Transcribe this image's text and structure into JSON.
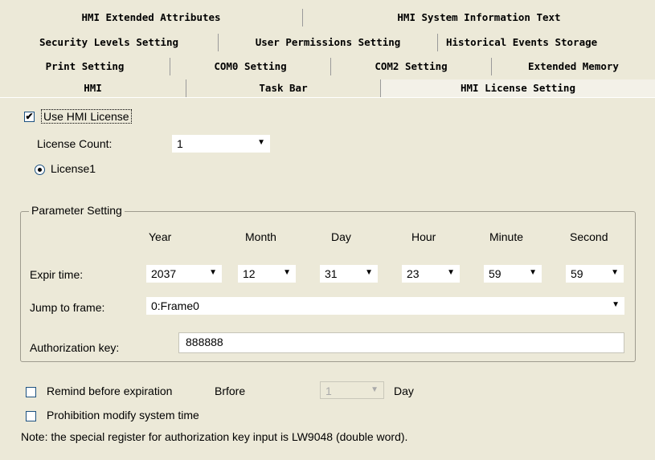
{
  "tabs": {
    "row1": [
      "HMI Extended Attributes",
      "HMI System Information Text"
    ],
    "row2": [
      "Security Levels Setting",
      "User Permissions Setting",
      "Historical Events Storage"
    ],
    "row3": [
      "Print Setting",
      "COM0 Setting",
      "COM2 Setting",
      "Extended Memory"
    ],
    "row4": [
      "HMI",
      "Task Bar",
      "HMI License Setting"
    ],
    "active": "HMI License Setting"
  },
  "license": {
    "use_label": "Use HMI License",
    "use_checked": true,
    "count_label": "License Count:",
    "count_value": "1",
    "radio_label": "License1",
    "radio_selected": true
  },
  "params": {
    "group_title": "Parameter Setting",
    "headers": [
      "Year",
      "Month",
      "Day",
      "Hour",
      "Minute",
      "Second"
    ],
    "expire_label": "Expir time:",
    "expire_values": [
      "2037",
      "12",
      "31",
      "23",
      "59",
      "59"
    ],
    "jump_label": "Jump to frame:",
    "jump_value": "0:Frame0",
    "auth_label": "Authorization key:",
    "auth_value": "888888"
  },
  "remind": {
    "label": "Remind before expiration",
    "before_label": "Brfore",
    "days_value": "1",
    "day_label": "Day",
    "checked": false
  },
  "prohibit": {
    "label": "Prohibition modify system time",
    "checked": false
  },
  "note": "Note: the special register for authorization key input is LW9048 (double word).",
  "icons": {
    "dropdown": "chevron-down-icon",
    "check": "check-icon"
  }
}
